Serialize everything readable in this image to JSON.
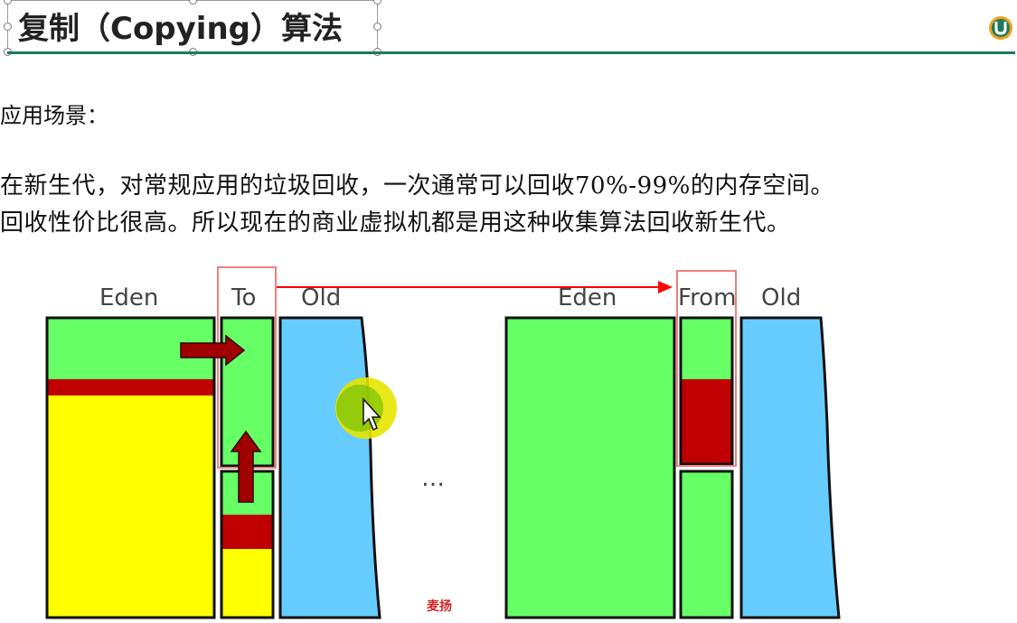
{
  "slide": {
    "title": "复制（Copying）算法",
    "section_label": "应用场景：",
    "body_lines": [
      "在新生代，对常规应用的垃圾回收，一次通常可以回收70%-99%的内存空间。",
      "回收性价比很高。所以现在的商业虚拟机都是用这种收集算法回收新生代。"
    ],
    "accent_color": "#1f7a5a"
  },
  "diagram": {
    "left": {
      "eden_label": "Eden",
      "to_label": "To",
      "old_label": "Old"
    },
    "right": {
      "eden_label": "Eden",
      "from_label": "From",
      "old_label": "Old"
    },
    "ellipsis": "…",
    "watermark": "麦扬",
    "colors": {
      "live_green": "#66ff66",
      "garbage_yellow": "#ffff00",
      "survivor_red": "#c00000",
      "old_blue": "#66ccff",
      "arrow_red": "#ff0000",
      "arrow_dark_red": "#a00000"
    }
  }
}
